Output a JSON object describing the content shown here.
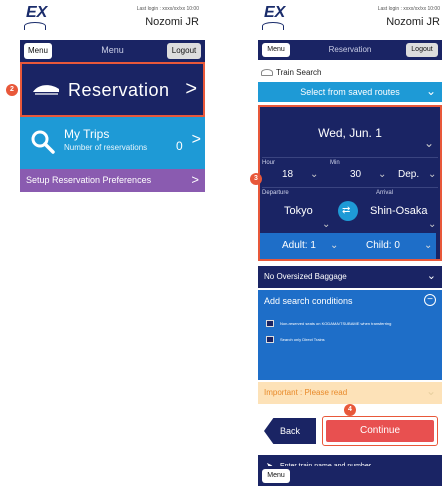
{
  "left": {
    "brand": "EX",
    "last_login": "Last login : xxxx/xx/xx 10:00",
    "user_name": "Nozomi JR",
    "menu_label": "Menu",
    "nav_title": "Menu",
    "logout_label": "Logout",
    "reservation_label": "Reservation",
    "reservation_badge": "2",
    "my_trips_label": "My Trips",
    "reservations_label": "Number of reservations",
    "reservations_count": "0",
    "prefs_label": "Setup Reservation Preferences",
    "chevron": ">"
  },
  "right": {
    "brand": "EX",
    "last_login": "Last login : xxxx/xx/xx 10:00",
    "user_name": "Nozomi JR",
    "menu_label": "Menu",
    "nav_title": "Reservation",
    "logout_label": "Logout",
    "train_search_label": "Train Search",
    "saved_routes_label": "Select from saved routes",
    "form_badge": "3",
    "date_value": "Wed, Jun. 1",
    "hour_label": "Hour",
    "hour_value": "18",
    "min_label": "Min",
    "min_value": "30",
    "dep_value": "Dep.",
    "departure_label": "Departure",
    "arrival_label": "Arrival",
    "departure_value": "Tokyo",
    "arrival_value": "Shin-Osaka",
    "adult_value": "Adult: 1",
    "child_value": "Child: 0",
    "baggage_label": "No Oversized Baggage",
    "add_conditions_label": "Add search conditions",
    "cb1_label": "Non-reserved seats on KODAMA/TSUBAME when transferring",
    "cb2_label": "Search only Direct Trains",
    "important_label": "Important : Please read",
    "continue_badge": "4",
    "back_label": "Back",
    "continue_label": "Continue",
    "train_name_label": "Enter train name and number",
    "bottom_menu_label": "Menu"
  },
  "colors": {
    "navy": "#1a2464",
    "blue": "#1e9ad6",
    "mid_blue": "#1e6ec8",
    "purple": "#8a5bb0",
    "accent_orange": "#e8583a",
    "continue_red": "#e85050",
    "warning_bg": "#fde2b8"
  }
}
